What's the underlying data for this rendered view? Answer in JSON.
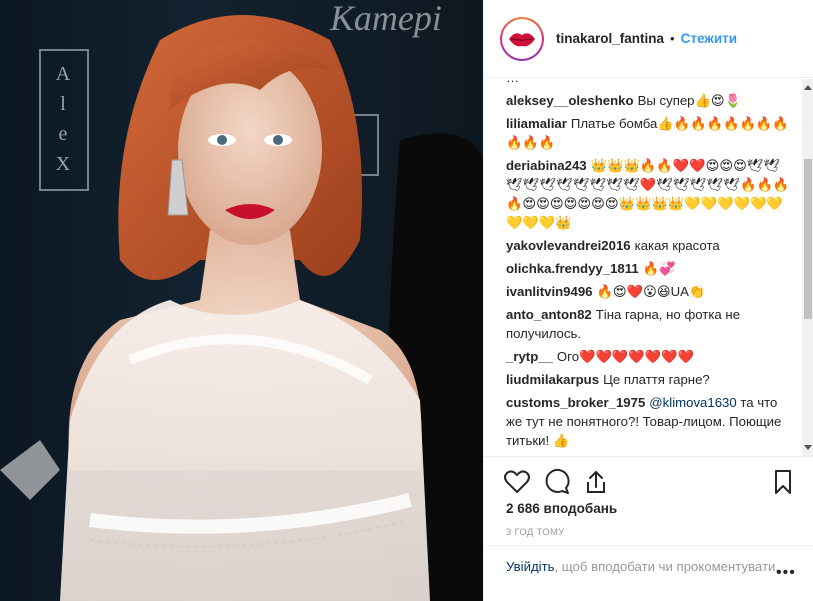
{
  "header": {
    "username": "tinakarol_fantina",
    "separator": "•",
    "follow_label": "Стежити"
  },
  "comments": [
    {
      "user": "",
      "text": "…"
    },
    {
      "user": "aleksey__oleshenko",
      "text": "Вы супер👍😍🌷"
    },
    {
      "user": "liliamaliar",
      "text": "Платье бомба👍🔥🔥🔥🔥🔥🔥🔥🔥🔥🔥"
    },
    {
      "user": "deriabina243",
      "text": "👑👑👑🔥🔥❤️❤️😍😍😍🕊🕊🕊🕊🕊🕊🕊🕊🕊🕊❤️🕊🕊🕊🕊🕊🔥🔥🔥🔥😍😍😍😍😍😍😍👑👑👑👑💛💛💛💛💛💛💛💛💛👑"
    },
    {
      "user": "yakovlevandrei2016",
      "text": "какая красота"
    },
    {
      "user": "olichka.frendyy_1811",
      "text": "🔥💞"
    },
    {
      "user": "ivanlitvin9496",
      "text": "🔥😍❤️😮😆UA👏"
    },
    {
      "user": "anto_anton82",
      "text": "Тіна гарна, но фотка не получилось."
    },
    {
      "user": "_rytp__",
      "text": "Ого❤️❤️❤️❤️❤️❤️❤️"
    },
    {
      "user": "liudmilakarpus",
      "text": "Це плаття гарне?"
    },
    {
      "user": "customs_broker_1975",
      "mention": "@klimova1630",
      "text": "та что же тут не понятного?! Товар-лицом. Поющие титьки! 👍"
    }
  ],
  "actions": {
    "like_icon": "heart-icon",
    "comment_icon": "comment-icon",
    "share_icon": "share-icon",
    "save_icon": "bookmark-icon"
  },
  "likes_text": "2 686 вподобань",
  "time_text": "3 ГОД ТОМУ",
  "footer": {
    "login_link": "Увійдіть",
    "rest_text": ", щоб вподобати чи прокоментувати.",
    "more_label": "•••"
  },
  "colors": {
    "link": "#003569",
    "follow": "#3897f0",
    "meta": "#999999",
    "text": "#262626"
  }
}
